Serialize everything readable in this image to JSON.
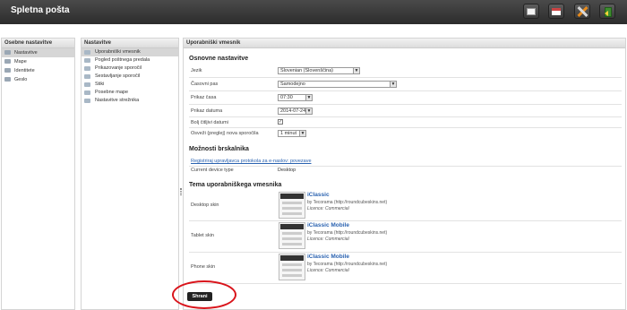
{
  "app": {
    "title": "Spletna pošta"
  },
  "toolbar": {
    "icons": [
      "compose-icon",
      "calendar-icon",
      "settings-icon",
      "logout-icon"
    ]
  },
  "sidebar": {
    "title": "Osebne nastavitve",
    "items": [
      {
        "label": "Nastavitve",
        "selected": true
      },
      {
        "label": "Mape"
      },
      {
        "label": "Identitete"
      },
      {
        "label": "Geslo"
      }
    ]
  },
  "sections_list": {
    "title": "Nastavitve",
    "items": [
      {
        "label": "Uporabniški vmesnik",
        "selected": true
      },
      {
        "label": "Pogled poštnega predala"
      },
      {
        "label": "Prikazovanje sporočil"
      },
      {
        "label": "Sestavljanje sporočil"
      },
      {
        "label": "Stiki"
      },
      {
        "label": "Posebne mape"
      },
      {
        "label": "Nastavitve strežnika"
      }
    ]
  },
  "main": {
    "title": "Uporabniški vmesnik",
    "basic": {
      "title": "Osnovne nastavitve",
      "language_label": "Jezik",
      "language_value": "Slovenian (Slovenščina)",
      "timezone_label": "Časovni pas",
      "timezone_value": "Samodejno",
      "time_format_label": "Prikaz časa",
      "time_format_value": "07:30",
      "date_format_label": "Prikaz datuma",
      "date_format_value": "2014-07-24",
      "pretty_dates_label": "Bolj čitljivi datumi",
      "pretty_dates_checked": true,
      "refresh_label": "Osveži (preglej) nova sporočila",
      "refresh_value": "1 minut"
    },
    "browser": {
      "title": "Možnosti brskalnika",
      "register_link": "Registriraj upravljavca protokola za e-naslov: povezave",
      "device_label": "Current device type",
      "device_value": "Desktop"
    },
    "theme": {
      "title": "Tema uporabniškega vmesnika",
      "skins": [
        {
          "label": "Desktop skin",
          "name": "iClassic",
          "author": "by Tecorama (http://roundcubeskins.net)",
          "license": "Licence: Commercial"
        },
        {
          "label": "Tablet skin",
          "name": "iClassic Mobile",
          "author": "by Tecorama (http://roundcubeskins.net)",
          "license": "Licence: Commercial"
        },
        {
          "label": "Phone skin",
          "name": "iClassic Mobile",
          "author": "by Tecorama (http://roundcubeskins.net)",
          "license": "Licence: Commercial"
        }
      ]
    },
    "save_label": "Shrani"
  },
  "colors": {
    "highlight_circle": "#d9141b",
    "link": "#2a62b0",
    "topbar": "#3a3a3a"
  }
}
